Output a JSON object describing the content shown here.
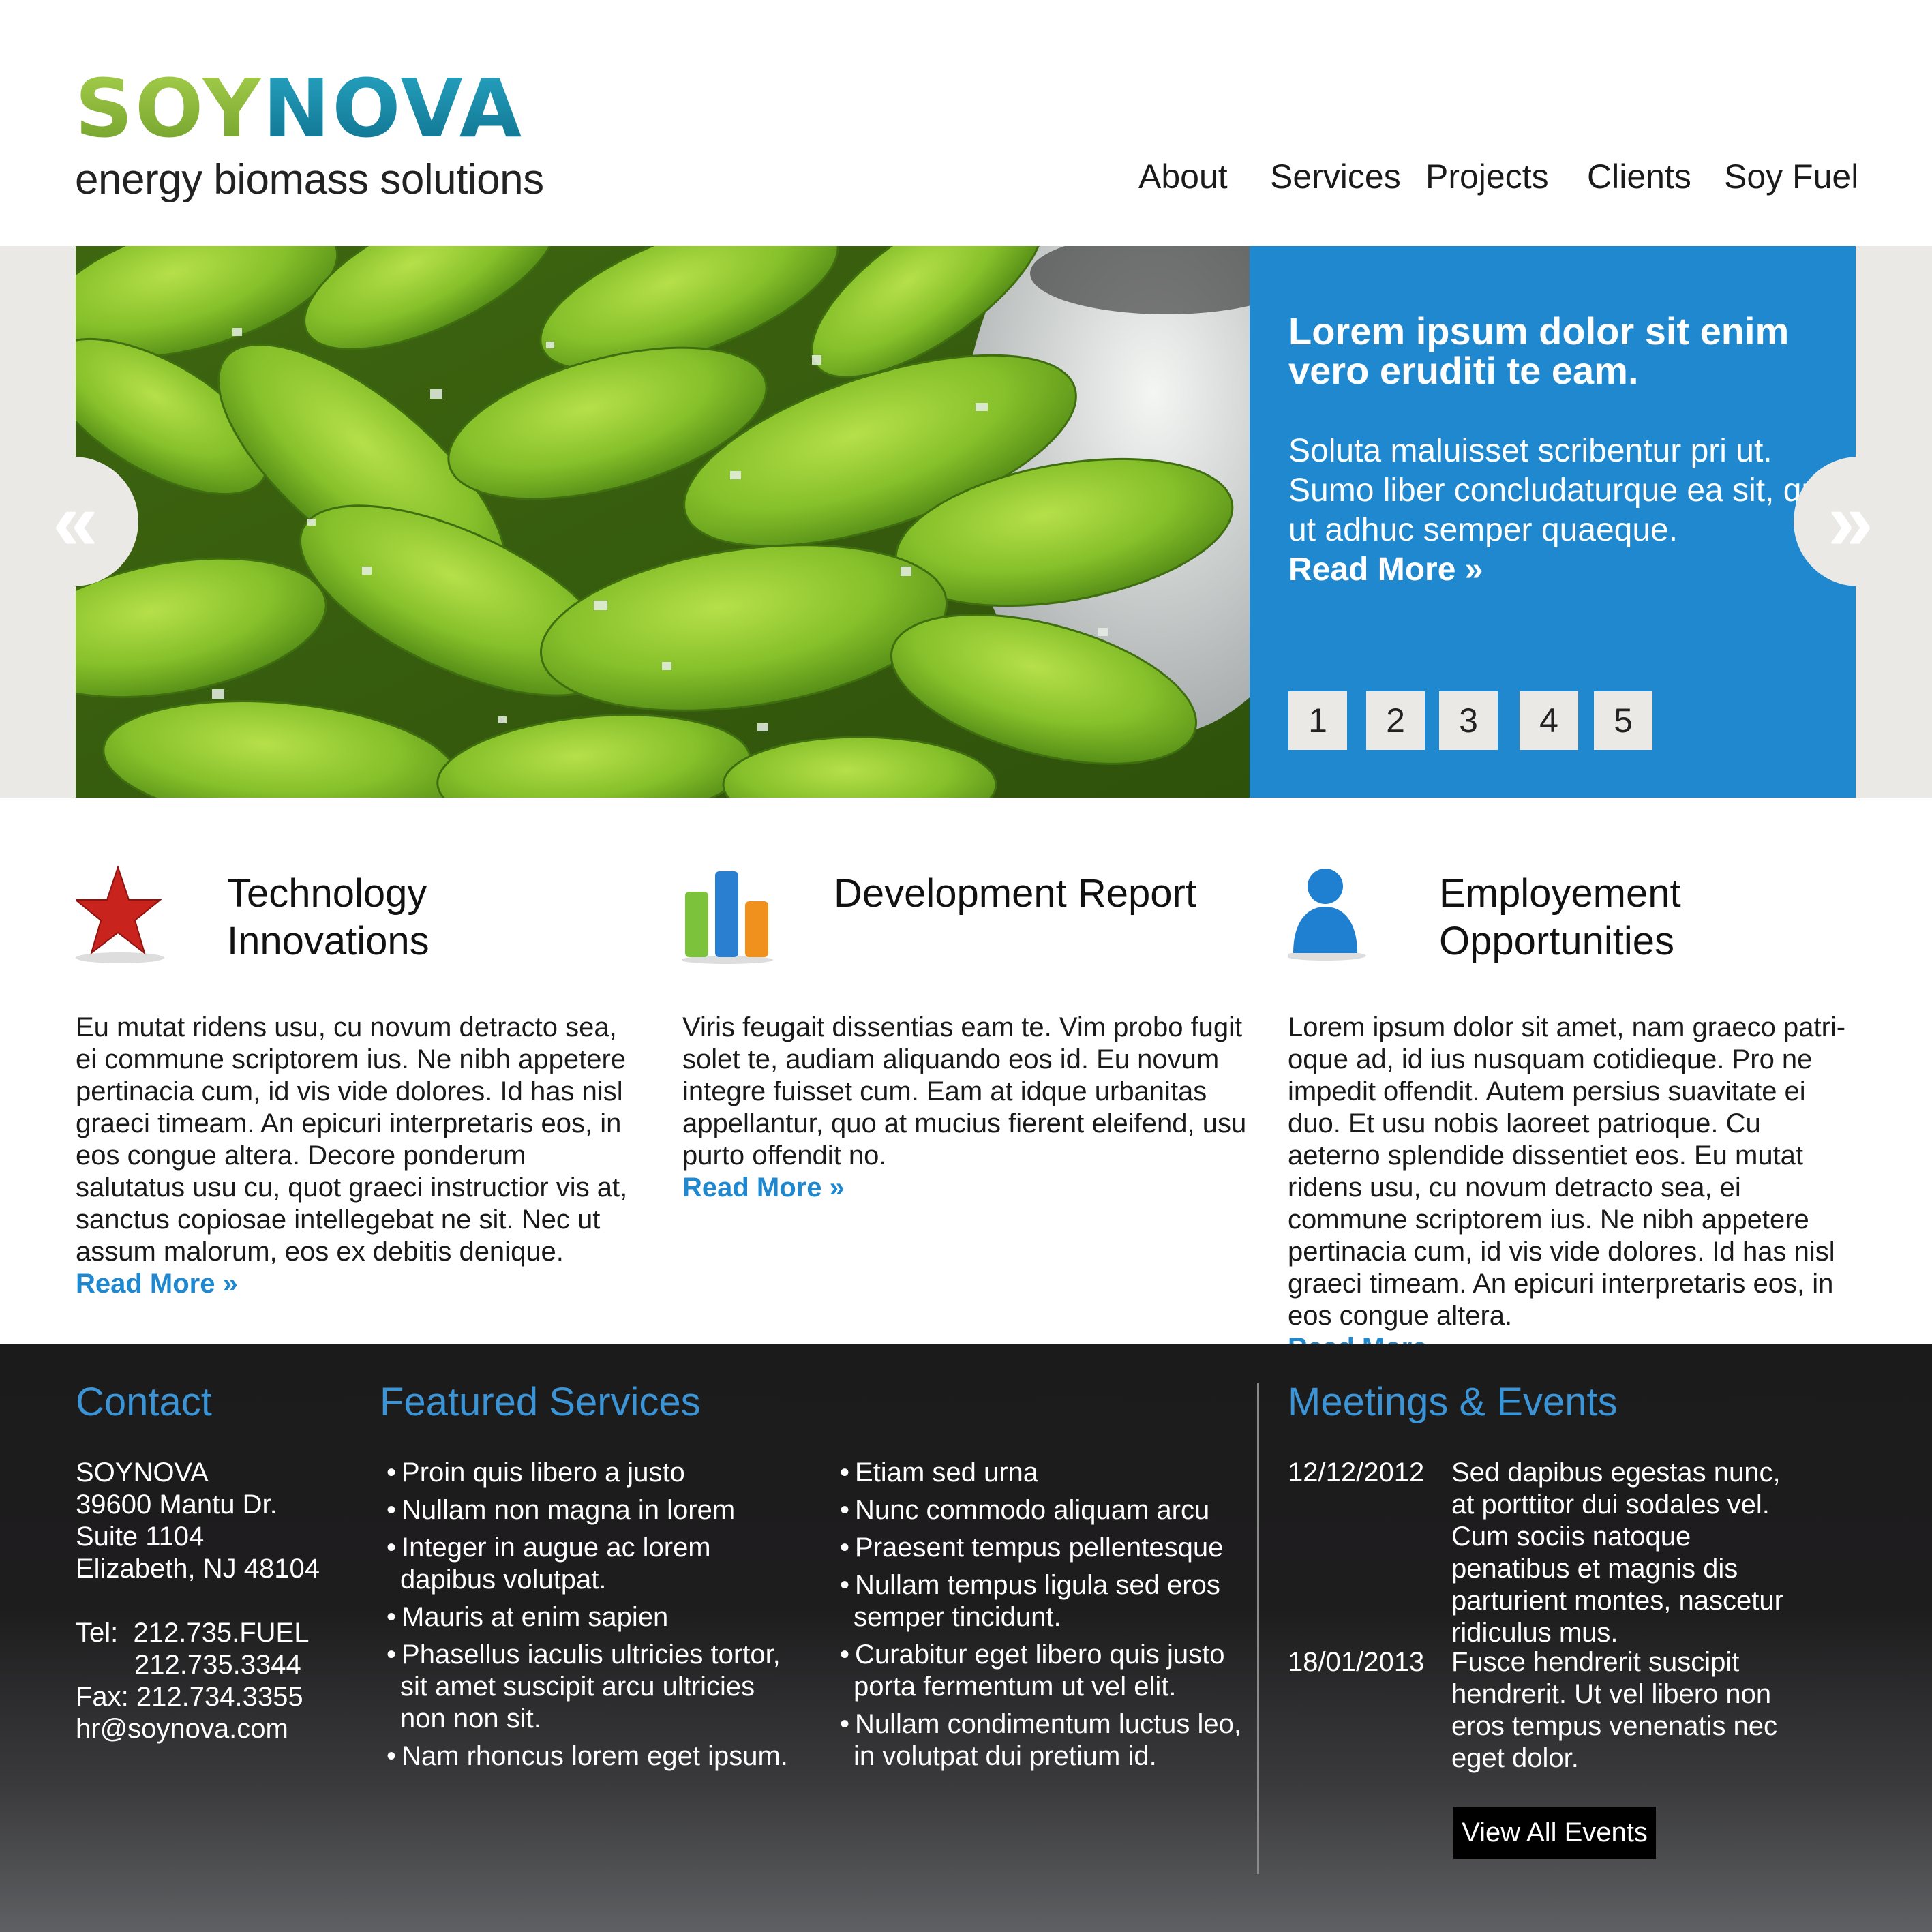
{
  "brand": {
    "name_part1": "SOY",
    "name_part2": "NOVA",
    "tagline": "energy biomass solutions",
    "color_soy": "#8cbf3a",
    "color_nova": "#1a8aa8"
  },
  "nav": {
    "items": [
      {
        "label": "About"
      },
      {
        "label": "Services"
      },
      {
        "label": "Projects"
      },
      {
        "label": "Clients"
      },
      {
        "label": "Soy Fuel"
      }
    ]
  },
  "hero": {
    "title": "Lorem ipsum dolor sit enim vero eruditi te eam.",
    "text": "Soluta maluisset scribentur pri ut. Sumo liber concludaturque ea sit, qui ut adhuc semper quaeque.",
    "read_more": "Read More »",
    "prev_arrow": "«",
    "next_arrow": "»",
    "pages": [
      "1",
      "2",
      "3",
      "4",
      "5"
    ],
    "panel_color": "#1f88cf"
  },
  "features": [
    {
      "icon": "star-icon",
      "title": "Technology Innovations",
      "body": "Eu mutat ridens usu, cu novum detracto sea, ei commune scriptorem ius. Ne nibh appetere pertinacia cum, id vis vide dolores. Id has nisl graeci timeam. An epicuri interpretaris eos, in eos congue altera. Decore ponderum salutatus usu cu, quot graeci instructior vis at, sanctus copiosae intellegebat ne sit. Nec ut assum malorum, eos ex debitis denique.",
      "read_more": "Read More »"
    },
    {
      "icon": "bar-chart-icon",
      "title": "Development Report",
      "body": "Viris feugait dissentias eam te. Vim probo fugit solet te, audiam aliquando eos id. Eu novum integre fuisset cum. Eam at idque urbanitas appellantur, quo at mucius fierent eleifend, usu purto offendit no.",
      "read_more": "Read More »"
    },
    {
      "icon": "person-icon",
      "title": "Employement Opportunities",
      "body": "Lorem ipsum dolor sit amet, nam graeco patri-oque ad, id ius nusquam cotidieque. Pro ne impedit offendit. Autem persius suavitate ei duo. Et usu nobis laoreet patrioque. Cu aeterno splendide dissentiet eos. Eu mutat ridens usu, cu novum detracto sea, ei commune scriptorem ius. Ne nibh appetere pertinacia cum, id vis vide dolores. Id has nisl graeci timeam. An epicuri interpretaris eos, in eos congue altera.",
      "read_more": "Read More »"
    }
  ],
  "footer": {
    "contact": {
      "heading": "Contact",
      "company": "SOYNOVA",
      "address1": "39600 Mantu Dr.",
      "address2": "Suite 1104",
      "city": "Elizabeth, NJ 48104",
      "tel_label": "Tel:",
      "tel1": "212.735.FUEL",
      "tel2": "212.735.3344",
      "fax": "Fax: 212.734.3355",
      "email": "hr@soynova.com"
    },
    "services": {
      "heading": "Featured Services",
      "col1": [
        "Proin quis libero a justo",
        "Nullam non magna in lorem",
        "Integer in augue ac lorem dapibus volutpat.",
        "Mauris at enim sapien",
        "Phasellus iaculis ultricies tortor, sit amet suscipit arcu ultricies non non sit.",
        "Nam rhoncus lorem eget ipsum."
      ],
      "col2": [
        "Etiam sed urna",
        "Nunc commodo aliquam arcu",
        "Praesent tempus pellentesque",
        "Nullam tempus ligula sed eros semper tincidunt.",
        "Curabitur eget libero quis justo porta fermentum ut vel elit.",
        "Nullam condimentum luctus leo, in volutpat dui pretium id."
      ]
    },
    "events": {
      "heading": "Meetings & Events",
      "items": [
        {
          "date": "12/12/2012",
          "text": "Sed dapibus egestas nunc, at porttitor dui sodales vel. Cum sociis natoque penatibus et magnis dis parturient montes, nascetur ridiculus mus."
        },
        {
          "date": "18/01/2013",
          "text": "Fusce hendrerit suscipit hendrerit. Ut vel libero non eros tempus venenatis nec eget dolor."
        }
      ],
      "view_all": "View All Events"
    },
    "heading_color": "#3a94d6"
  }
}
